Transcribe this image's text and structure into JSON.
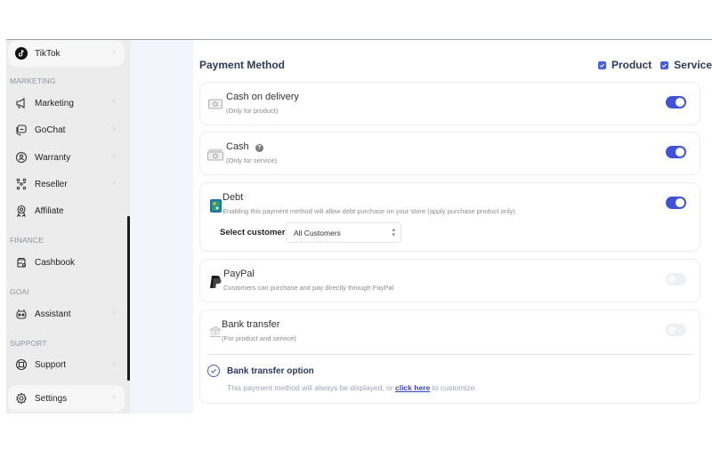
{
  "sidebar": {
    "items": [
      {
        "label": "TikTok",
        "icon": "tiktok-icon",
        "chevron": true,
        "active": true
      },
      {
        "label": "Marketing",
        "icon": "megaphone-icon",
        "chevron": true
      },
      {
        "label": "GoChat",
        "icon": "chat-icon",
        "chevron": true
      },
      {
        "label": "Warranty",
        "icon": "warranty-badge-icon",
        "chevron": true
      },
      {
        "label": "Reseller",
        "icon": "reseller-network-icon",
        "chevron": true
      },
      {
        "label": "Affiliate",
        "icon": "affiliate-award-icon",
        "chevron": false
      },
      {
        "label": "Cashbook",
        "icon": "cashbook-icon",
        "chevron": false
      },
      {
        "label": "Assistant",
        "icon": "robot-icon",
        "chevron": true
      },
      {
        "label": "Support",
        "icon": "lifebuoy-icon",
        "chevron": true
      },
      {
        "label": "Settings",
        "icon": "gear-icon",
        "chevron": true,
        "active": true
      }
    ],
    "sections": {
      "marketing": "MARKETING",
      "finance": "FINANCE",
      "goai": "GOAI",
      "support": "SUPPORT"
    },
    "chevron_glyph": "›"
  },
  "payment": {
    "title": "Payment Method",
    "filters": [
      {
        "label": "Product",
        "checked": true
      },
      {
        "label": "Service",
        "checked": true
      }
    ],
    "methods": [
      {
        "title": "Cash on delivery",
        "subtitle": "(Only for product)",
        "enabled": true,
        "icon": "cash-on-delivery-icon"
      },
      {
        "title": "Cash",
        "subtitle": "(Only for service)",
        "enabled": true,
        "icon": "cash-icon",
        "help": "?"
      },
      {
        "title": "Debt",
        "subtitle": "Enabling this payment method will allow debt purchase on your store (apply purchase product only)",
        "enabled": true,
        "icon": "debt-icon",
        "select_label": "Select customers",
        "select_value": "All Customers"
      },
      {
        "title": "PayPal",
        "subtitle": "Customers can purchase and pay directly through PayPal",
        "enabled": false,
        "icon": "paypal-icon"
      },
      {
        "title": "Bank transfer",
        "subtitle": "(For product and service)",
        "enabled": false,
        "icon": "bank-icon",
        "option_title": "Bank transfer option",
        "option_desc_before": "This payment method will always be displayed, or ",
        "option_link": "click here",
        "option_desc_after": " to customize"
      }
    ],
    "drag_glyph": "↓"
  }
}
